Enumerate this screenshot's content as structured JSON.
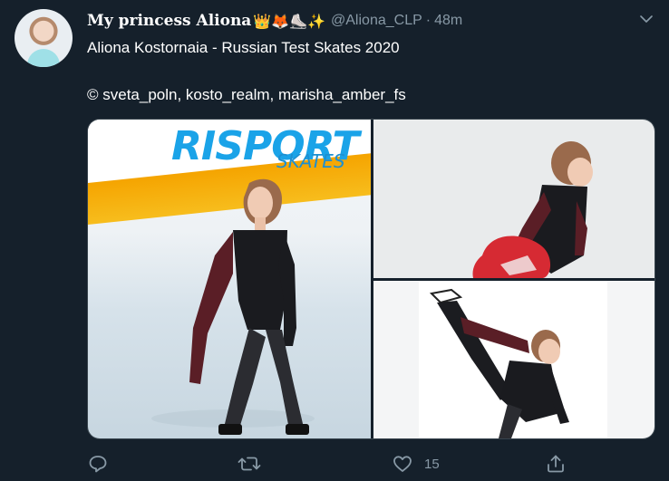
{
  "tweet": {
    "display_name": "My princess Aliona",
    "emojis": "👑🦊⛸️✨",
    "handle": "@Aliona_CLP",
    "separator": "·",
    "time": "48m",
    "text_line1": "Aliona Kostornaia - Russian Test Skates 2020",
    "text_line2": "© sveta_poln, kosto_realm, marisha_amber_fs"
  },
  "media": {
    "photo1_sign": "RISPORT",
    "photo1_sign_sub": "SKATES"
  },
  "actions": {
    "reply_count": "",
    "retweet_count": "",
    "like_count": "15",
    "share_count": ""
  },
  "colors": {
    "background": "#15202b",
    "secondary_text": "#8899a6",
    "primary_text": "#ffffff"
  },
  "icons": [
    "chevron-down-icon",
    "reply-icon",
    "retweet-icon",
    "like-icon",
    "share-icon"
  ]
}
